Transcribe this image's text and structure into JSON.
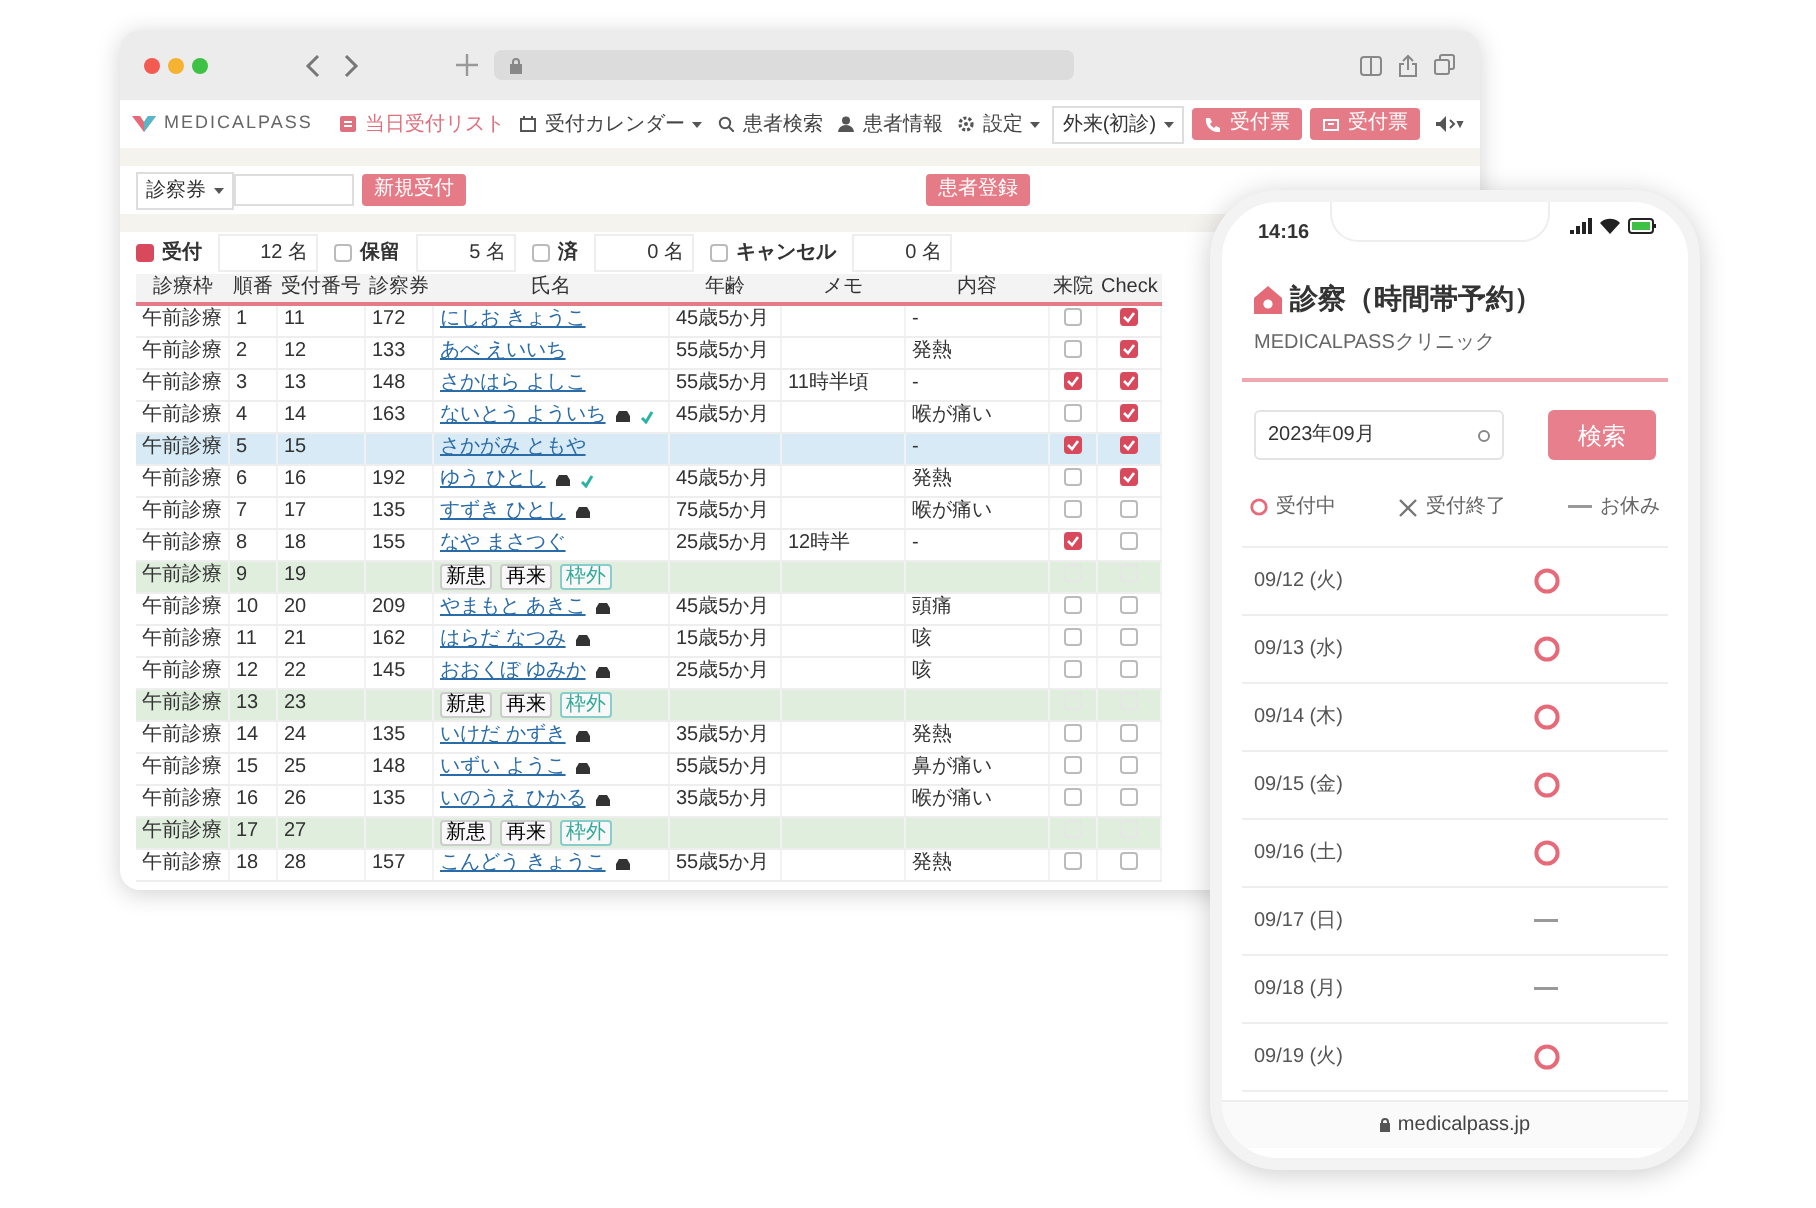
{
  "app": {
    "logo": "MEDICALPASS",
    "nav": [
      {
        "label": "当日受付リスト",
        "selected": true,
        "dropdown": false
      },
      {
        "label": "受付カレンダー",
        "selected": false,
        "dropdown": true
      },
      {
        "label": "患者検索",
        "selected": false,
        "dropdown": false
      },
      {
        "label": "患者情報",
        "selected": false,
        "dropdown": false
      },
      {
        "label": "設定",
        "selected": false,
        "dropdown": true
      }
    ],
    "mode_select": "外来(初診)",
    "header_buttons": [
      "受付票",
      "受付票"
    ]
  },
  "filter": {
    "field_select": "診察券",
    "new_button": "新規受付",
    "register_button": "患者登録"
  },
  "counts": [
    {
      "label": "受付",
      "count": "12",
      "unit": "名",
      "checked": true
    },
    {
      "label": "保留",
      "count": "5",
      "unit": "名",
      "checked": false
    },
    {
      "label": "済",
      "count": "0",
      "unit": "名",
      "checked": false
    },
    {
      "label": "キャンセル",
      "count": "0",
      "unit": "名",
      "checked": false
    }
  ],
  "table": {
    "columns": [
      "診療枠",
      "順番",
      "受付番号",
      "診察券",
      "氏名",
      "年齢",
      "メモ",
      "内容",
      "来院",
      "Check"
    ],
    "rows": [
      {
        "kind": "patient",
        "highlighted": false,
        "slot": "午前診療",
        "order": "1",
        "number": "11",
        "card": "172",
        "name": "にしお きょうこ",
        "car": false,
        "verified": false,
        "age": "45歳5か月",
        "content": "-",
        "visited": false,
        "checked": true
      },
      {
        "kind": "patient",
        "highlighted": false,
        "slot": "午前診療",
        "order": "2",
        "number": "12",
        "card": "133",
        "name": "あべ えいいち",
        "car": false,
        "verified": false,
        "age": "55歳5か月",
        "content": "発熱",
        "visited": false,
        "checked": true
      },
      {
        "kind": "patient",
        "highlighted": false,
        "slot": "午前診療",
        "order": "3",
        "number": "13",
        "card": "148",
        "name": "さかはら よしこ",
        "car": false,
        "verified": false,
        "age": "55歳5か月",
        "memo": "11時半頃",
        "content": "-",
        "visited": true,
        "checked": true
      },
      {
        "kind": "patient",
        "highlighted": false,
        "slot": "午前診療",
        "order": "4",
        "number": "14",
        "card": "163",
        "name": "ないとう よういち",
        "car": true,
        "verified": true,
        "age": "45歳5か月",
        "content": "喉が痛い",
        "visited": false,
        "checked": true
      },
      {
        "kind": "patient",
        "highlighted": true,
        "slot": "午前診療",
        "order": "5",
        "number": "15",
        "name": "さかがみ ともや",
        "car": false,
        "verified": false,
        "content": "-",
        "visited": true,
        "checked": true
      },
      {
        "kind": "patient",
        "highlighted": false,
        "slot": "午前診療",
        "order": "6",
        "number": "16",
        "card": "192",
        "name": "ゆう ひとし",
        "car": true,
        "verified": true,
        "age": "45歳5か月",
        "content": "発熱",
        "visited": false,
        "checked": true
      },
      {
        "kind": "patient",
        "highlighted": false,
        "slot": "午前診療",
        "order": "7",
        "number": "17",
        "card": "135",
        "name": "すずき ひとし",
        "car": true,
        "verified": false,
        "age": "75歳5か月",
        "content": "喉が痛い",
        "visited": false,
        "checked": false
      },
      {
        "kind": "patient",
        "highlighted": false,
        "slot": "午前診療",
        "order": "8",
        "number": "18",
        "card": "155",
        "name": "なや まさつぐ",
        "car": false,
        "verified": false,
        "age": "25歳5か月",
        "memo": "12時半",
        "content": "-",
        "visited": true,
        "checked": false
      },
      {
        "kind": "slot",
        "slot": "午前診療",
        "order": "9",
        "number": "19",
        "buttons": [
          "新患",
          "再来",
          "枠外"
        ],
        "visited": false,
        "checked": false,
        "disabled": true
      },
      {
        "kind": "patient",
        "highlighted": false,
        "slot": "午前診療",
        "order": "10",
        "number": "20",
        "card": "209",
        "name": "やまもと あきこ",
        "car": true,
        "verified": false,
        "age": "45歳5か月",
        "content": "頭痛",
        "visited": false,
        "checked": false
      },
      {
        "kind": "patient",
        "highlighted": false,
        "slot": "午前診療",
        "order": "11",
        "number": "21",
        "card": "162",
        "name": "はらだ なつみ",
        "car": true,
        "verified": false,
        "age": "15歳5か月",
        "content": "咳",
        "visited": false,
        "checked": false
      },
      {
        "kind": "patient",
        "highlighted": false,
        "slot": "午前診療",
        "order": "12",
        "number": "22",
        "card": "145",
        "name": "おおくぼ ゆみか",
        "car": true,
        "verified": false,
        "age": "25歳5か月",
        "content": "咳",
        "visited": false,
        "checked": false
      },
      {
        "kind": "slot",
        "slot": "午前診療",
        "order": "13",
        "number": "23",
        "buttons": [
          "新患",
          "再来",
          "枠外"
        ],
        "visited": false,
        "checked": false,
        "disabled": true
      },
      {
        "kind": "patient",
        "highlighted": false,
        "slot": "午前診療",
        "order": "14",
        "number": "24",
        "card": "135",
        "name": "いけだ かずき",
        "car": true,
        "verified": false,
        "age": "35歳5か月",
        "content": "発熱",
        "visited": false,
        "checked": false
      },
      {
        "kind": "patient",
        "highlighted": false,
        "slot": "午前診療",
        "order": "15",
        "number": "25",
        "card": "148",
        "name": "いずい ようこ",
        "car": true,
        "verified": false,
        "age": "55歳5か月",
        "content": "鼻が痛い",
        "visited": false,
        "checked": false
      },
      {
        "kind": "patient",
        "highlighted": false,
        "slot": "午前診療",
        "order": "16",
        "number": "26",
        "card": "135",
        "name": "いのうえ ひかる",
        "car": true,
        "verified": false,
        "age": "35歳5か月",
        "content": "喉が痛い",
        "visited": false,
        "checked": false
      },
      {
        "kind": "slot",
        "slot": "午前診療",
        "order": "17",
        "number": "27",
        "buttons": [
          "新患",
          "再来",
          "枠外"
        ],
        "visited": false,
        "checked": false,
        "disabled": true
      },
      {
        "kind": "patient",
        "highlighted": false,
        "slot": "午前診療",
        "order": "18",
        "number": "28",
        "card": "157",
        "name": "こんどう きょうこ",
        "car": true,
        "verified": false,
        "age": "55歳5か月",
        "content": "発熱",
        "visited": false,
        "checked": false
      }
    ]
  },
  "phone": {
    "time": "14:16",
    "title": "診察（時間帯予約）",
    "clinic": "MEDICALPASSクリニック",
    "month": "2023年09月",
    "search_button": "検索",
    "legend": [
      {
        "kind": "open",
        "label": "受付中"
      },
      {
        "kind": "closed",
        "label": "受付終了"
      },
      {
        "kind": "holiday",
        "label": "お休み"
      }
    ],
    "days": [
      {
        "date": "09/12 (火)",
        "kind": "open"
      },
      {
        "date": "09/13 (水)",
        "kind": "open"
      },
      {
        "date": "09/14 (木)",
        "kind": "open"
      },
      {
        "date": "09/15 (金)",
        "kind": "open"
      },
      {
        "date": "09/16 (土)",
        "kind": "open"
      },
      {
        "date": "09/17 (日)",
        "kind": "holiday"
      },
      {
        "date": "09/18 (月)",
        "kind": "holiday"
      },
      {
        "date": "09/19 (火)",
        "kind": "open"
      }
    ],
    "url": "medicalpass.jp"
  }
}
